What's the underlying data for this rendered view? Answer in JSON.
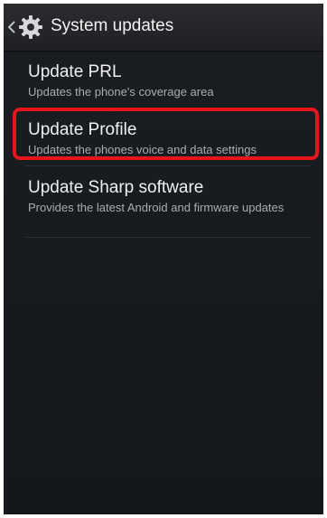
{
  "header": {
    "title": "System updates"
  },
  "items": [
    {
      "title": "Update PRL",
      "subtitle": "Updates the phone's coverage area"
    },
    {
      "title": "Update Profile",
      "subtitle": "Updates the phones voice and data settings"
    },
    {
      "title": "Update Sharp software",
      "subtitle": "Provides the latest Android and firmware updates"
    }
  ],
  "colors": {
    "background": "#16191e",
    "highlight": "#e8141c",
    "title_text": "#f0f0f0",
    "subtitle_text": "#a9acb0"
  },
  "icons": {
    "back": "chevron-left-icon",
    "app": "gear-icon"
  }
}
